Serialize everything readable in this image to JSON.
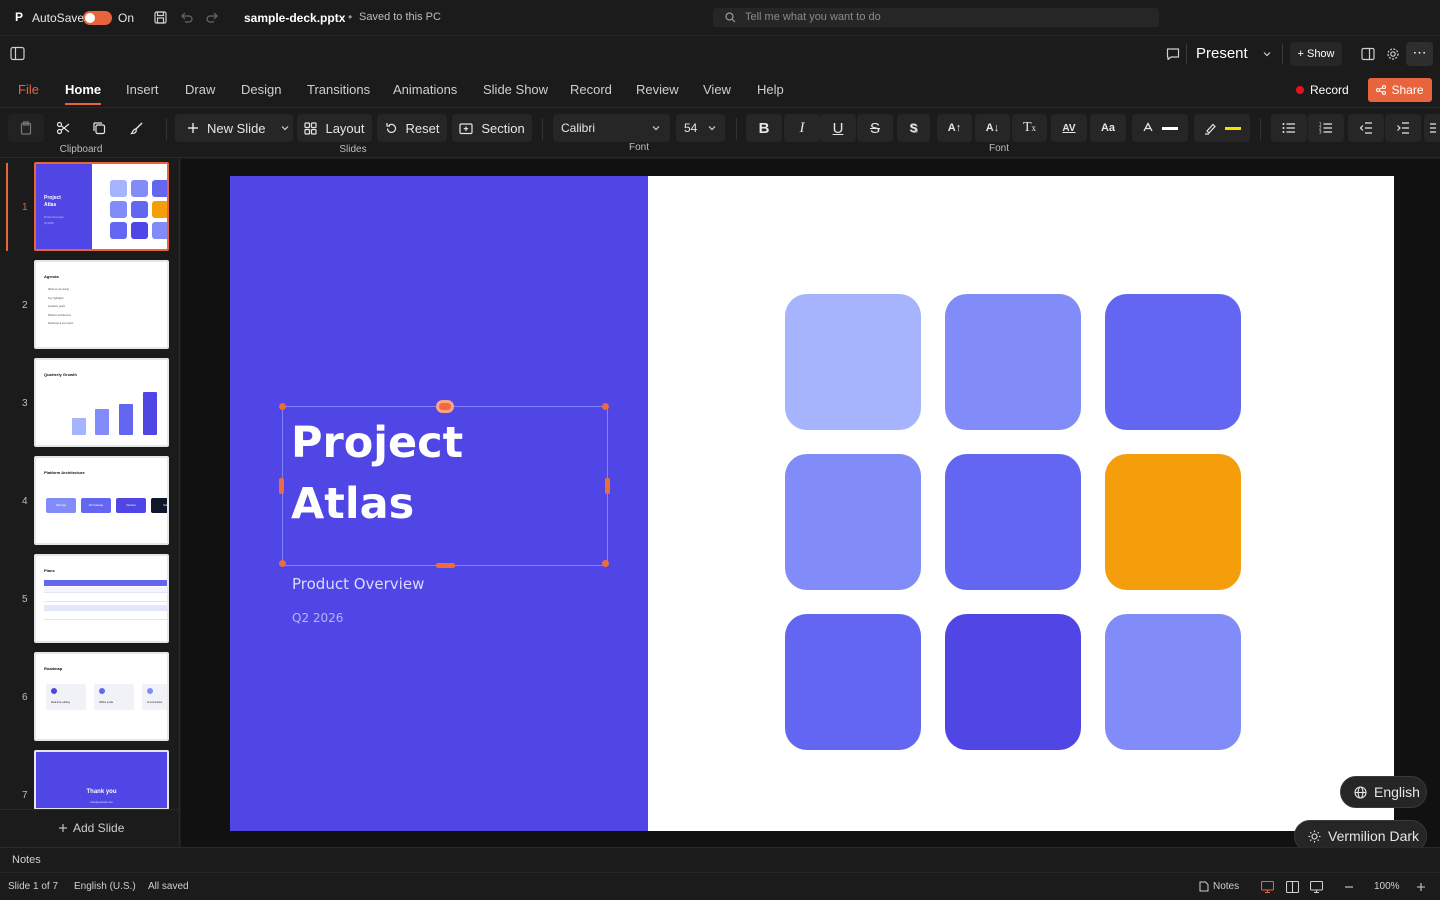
{
  "app": {
    "logo_letter": "P",
    "autosave_label": "AutoSave",
    "autosave_state": "On",
    "file_name": "sample-deck.pptx",
    "save_status": "Saved to this PC",
    "search_placeholder": "Tell me what you want to do"
  },
  "toolbar2": {
    "present_label": "Present",
    "show_label": "+ Show"
  },
  "tabs": [
    "File",
    "Home",
    "Insert",
    "Draw",
    "Design",
    "Transitions",
    "Animations",
    "Slide Show",
    "Record",
    "Review",
    "View",
    "Help"
  ],
  "active_tab": "Home",
  "record_label": "Record",
  "share_label": "Share",
  "ribbon": {
    "clipboard_group": "Clipboard",
    "new_slide": "New Slide",
    "layout": "Layout",
    "reset": "Reset",
    "section": "Section",
    "slides_group": "Slides",
    "font_name": "Calibri",
    "font_size": "54",
    "font_group": "Font",
    "font_group2": "Font",
    "font_color": "#ffffff",
    "highlight_color": "#f5e000"
  },
  "thumbnails": [
    {
      "num": "1",
      "title": "Project Atlas",
      "subtitle": "Product Overview",
      "date": "Q2 2026"
    },
    {
      "num": "2",
      "title": "Agenda",
      "items": [
        "What we are doing",
        "Key highlights",
        "Quarterly goals",
        "Platform architecture",
        "Roadmap & next steps"
      ]
    },
    {
      "num": "3",
      "title": "Quarterly Growth"
    },
    {
      "num": "4",
      "title": "Platform Architecture",
      "boxes": [
        "Web App",
        "API Gateway",
        "Services",
        "Data"
      ]
    },
    {
      "num": "5",
      "title": "Plans"
    },
    {
      "num": "6",
      "title": "Roadmap",
      "items": [
        "Real-time editing",
        "Offline mode",
        "AI summaries"
      ]
    },
    {
      "num": "7",
      "title": "Thank you",
      "subtitle": "hello@example.com"
    }
  ],
  "add_slide": "Add Slide",
  "slide": {
    "title_line1": "Project",
    "title_line2": "Atlas",
    "subtitle": "Product Overview",
    "date": "Q2 2026",
    "bg_color": "#4f46e5",
    "tile_colors": [
      "#a5b4fc",
      "#818cf8",
      "#6366f1",
      "#818cf8",
      "#6366f1",
      "#f59e0b",
      "#6366f1",
      "#4f46e5",
      "#818cf8"
    ]
  },
  "floating": {
    "language": "English",
    "theme": "Vermilion Dark"
  },
  "notes_label": "Notes",
  "status": {
    "slide_count": "Slide 1 of 7",
    "language": "English (U.S.)",
    "saved": "All saved",
    "notes": "Notes",
    "zoom": "100%"
  }
}
